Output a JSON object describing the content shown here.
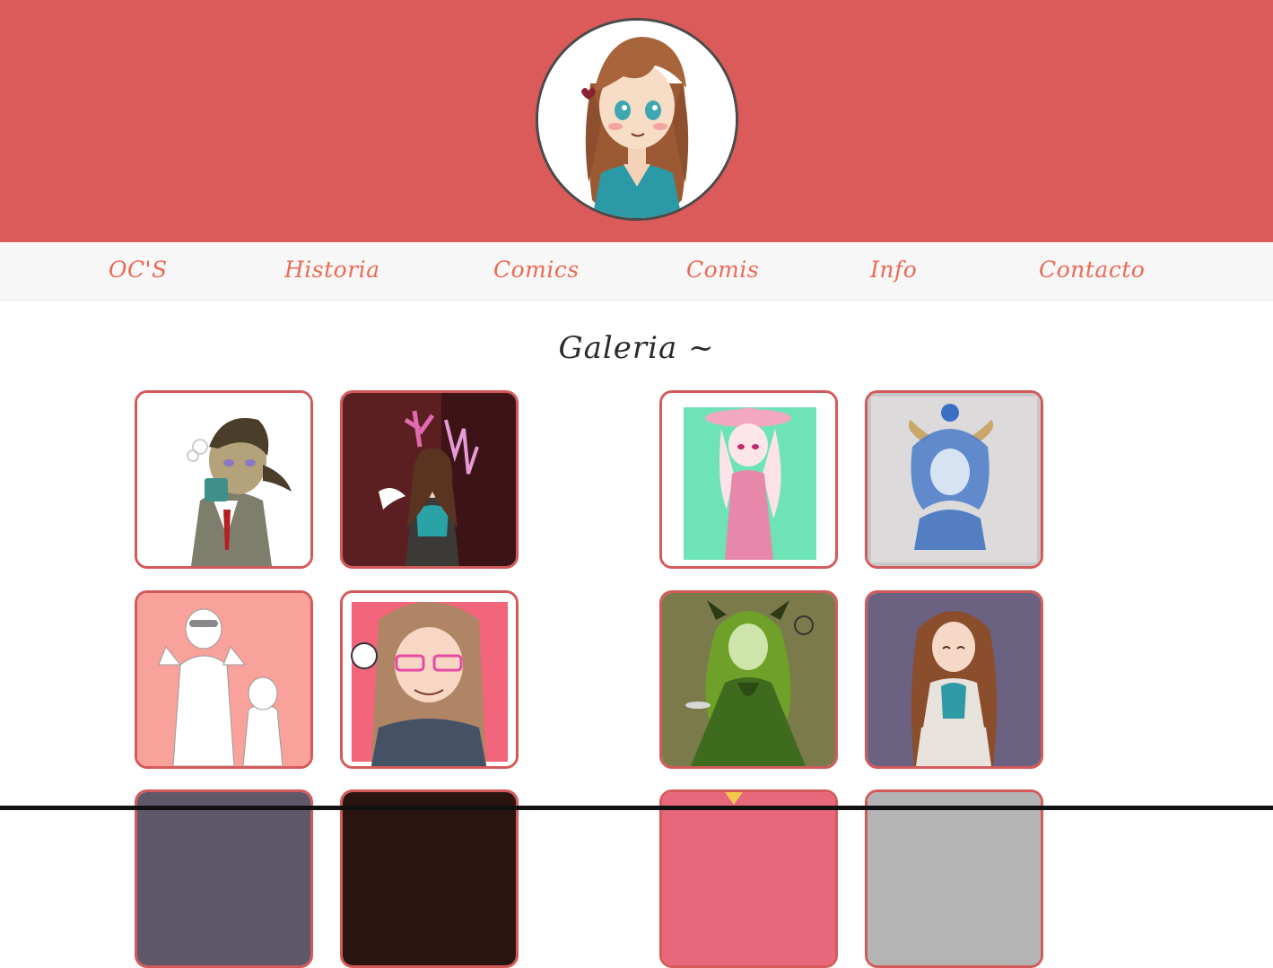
{
  "nav": {
    "items": [
      {
        "label": "OC'S"
      },
      {
        "label": "Historia"
      },
      {
        "label": "Comics"
      },
      {
        "label": "Comis"
      },
      {
        "label": "Info"
      },
      {
        "label": "Contacto"
      }
    ]
  },
  "gallery": {
    "title": "Galeria ~",
    "images": [
      {
        "name": "gallery-image-coffee-character",
        "bg": "#ffffff"
      },
      {
        "name": "gallery-image-crystal-character",
        "bg": "#5b1f22"
      },
      {
        "name": "gallery-image-pink-hat-character",
        "bg": "#6fe3b8"
      },
      {
        "name": "gallery-image-watercolor-character",
        "bg": "#c8c5c7"
      },
      {
        "name": "gallery-image-sketch-characters",
        "bg": "#f9a29c"
      },
      {
        "name": "gallery-image-glasses-character",
        "bg": "#f2657a"
      },
      {
        "name": "gallery-image-green-dress-character",
        "bg": "#7a7a4a"
      },
      {
        "name": "gallery-image-sitting-character",
        "bg": "#6b6282"
      },
      {
        "name": "gallery-image-row3-1",
        "bg": "#5f5868"
      },
      {
        "name": "gallery-image-row3-2",
        "bg": "#2a1410"
      },
      {
        "name": "gallery-image-row3-3",
        "bg": "#e7677b"
      },
      {
        "name": "gallery-image-row3-4",
        "bg": "#b4b4b4"
      }
    ]
  },
  "colors": {
    "header": "#db5b5b",
    "nav_text": "#ec6a55",
    "thumb_border": "#d45a5a"
  }
}
